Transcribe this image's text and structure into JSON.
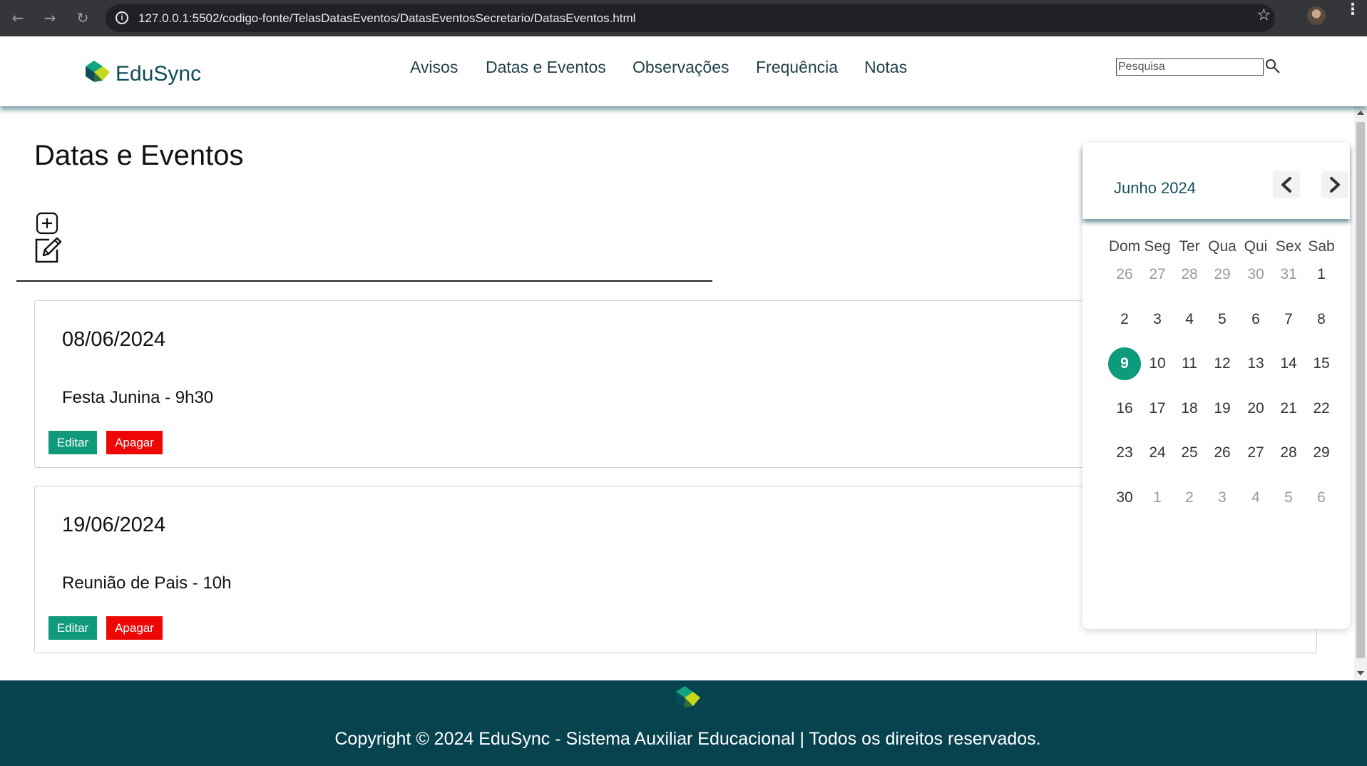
{
  "browser": {
    "url": "127.0.0.1:5502/codigo-fonte/TelasDatasEventos/DatasEventosSecretario/DatasEventos.html"
  },
  "header": {
    "brand": "EduSync",
    "nav": [
      "Avisos",
      "Datas e Eventos",
      "Observações",
      "Frequência",
      "Notas"
    ],
    "search_placeholder": "Pesquisa"
  },
  "main": {
    "title": "Datas e Eventos",
    "events": [
      {
        "date": "08/06/2024",
        "description": "Festa Junina - 9h30",
        "edit_label": "Editar",
        "delete_label": "Apagar"
      },
      {
        "date": "19/06/2024",
        "description": "Reunião de Pais - 10h",
        "edit_label": "Editar",
        "delete_label": "Apagar"
      }
    ]
  },
  "calendar": {
    "month_label": "Junho 2024",
    "weekdays": [
      "Dom",
      "Seg",
      "Ter",
      "Qua",
      "Qui",
      "Sex",
      "Sab"
    ],
    "weeks": [
      [
        "26",
        "27",
        "28",
        "29",
        "30",
        "31",
        "1"
      ],
      [
        "2",
        "3",
        "4",
        "5",
        "6",
        "7",
        "8"
      ],
      [
        "9",
        "10",
        "11",
        "12",
        "13",
        "14",
        "15"
      ],
      [
        "16",
        "17",
        "18",
        "19",
        "20",
        "21",
        "22"
      ],
      [
        "23",
        "24",
        "25",
        "26",
        "27",
        "28",
        "29"
      ],
      [
        "30",
        "1",
        "2",
        "3",
        "4",
        "5",
        "6"
      ]
    ],
    "leading_muted": 6,
    "trailing_muted": 6,
    "today": "9",
    "today_color": "#0d9b7d"
  },
  "footer": {
    "copyright": "Copyright © 2024 EduSync - Sistema Auxiliar Educacional | Todos os direitos reservados."
  },
  "colors": {
    "accent": "#10997b",
    "danger": "#ee0707",
    "footer_bg": "#07434e",
    "brand_text": "#0d4c57"
  }
}
